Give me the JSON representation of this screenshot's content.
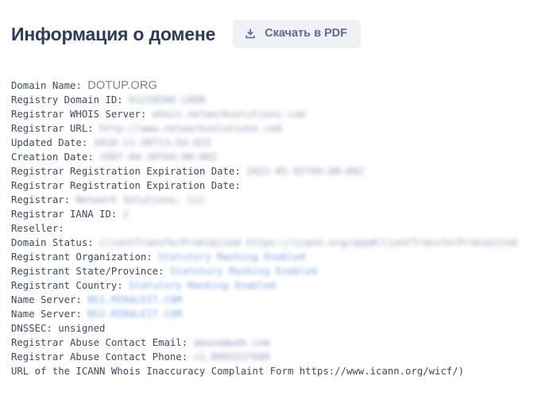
{
  "header": {
    "title": "Информация о домене",
    "pdf_button": {
      "label": "Скачать в PDF",
      "icon": "download-icon"
    }
  },
  "colors": {
    "title": "#2f3b5c",
    "button_bg": "#eff1f5",
    "button_text": "#5b6b93",
    "mono_text": "#3c4a6b",
    "masked_value": "#7d8aa6",
    "masked_value_blue": "#6f9fe0"
  },
  "whois": {
    "lines": [
      {
        "label": "Domain Name:",
        "value": "DOTUP.ORG",
        "style": "domain"
      },
      {
        "label": "Registry Domain ID:",
        "value": "D1234566-LROR",
        "style": "masked"
      },
      {
        "label": "Registrar WHOIS Server:",
        "value": "whois.networksolutions.com",
        "style": "masked"
      },
      {
        "label": "Registrar URL:",
        "value": "http://www.networksolutions.com",
        "style": "masked"
      },
      {
        "label": "Updated Date:",
        "value": "2018-11-20T13:54:02Z",
        "style": "masked"
      },
      {
        "label": "Creation Date:",
        "value": "1997-04-30T04:00:00Z",
        "style": "masked"
      },
      {
        "label": "Registrar Registration Expiration Date:",
        "value": "2021-05-01T04:00:00Z",
        "style": "masked"
      },
      {
        "label": "Registrar Registration Expiration Date:",
        "value": "",
        "style": "none"
      },
      {
        "label": "Registrar:",
        "value": "Network Solutions, LLC",
        "style": "masked"
      },
      {
        "label": "Registrar IANA ID:",
        "value": "2",
        "style": "masked"
      },
      {
        "label": "Reseller:",
        "value": "",
        "style": "none"
      },
      {
        "label": "Domain Status:",
        "value": "clientTransferProhibited https://icann.org/epp#clientTransferProhibited",
        "style": "masked"
      },
      {
        "label": "Registrant Organization:",
        "value": "Statutory Masking Enabled",
        "style": "masked-blue"
      },
      {
        "label": "Registrant State/Province:",
        "value": "Statutory Masking Enabled",
        "style": "masked-blue"
      },
      {
        "label": "Registrant Country:",
        "value": "Statutory Masking Enabled",
        "style": "masked-blue"
      },
      {
        "label": "Name Server:",
        "value": "NS1.MIRALEIT.COM",
        "style": "masked-blue"
      },
      {
        "label": "Name Server:",
        "value": "NS2.MIRALEIT.COM",
        "style": "masked-blue"
      },
      {
        "label": "DNSSEC:",
        "value": "unsigned",
        "style": "plain"
      },
      {
        "label": "Registrar Abuse Contact Email:",
        "value": "abuse@web.com",
        "style": "masked"
      },
      {
        "label": "Registrar Abuse Contact Phone:",
        "value": "+1.8003337680",
        "style": "masked"
      },
      {
        "label": "URL of the ICANN Whois Inaccuracy Complaint Form https://www.icann.org/wicf/)",
        "value": "",
        "style": "none"
      }
    ]
  }
}
